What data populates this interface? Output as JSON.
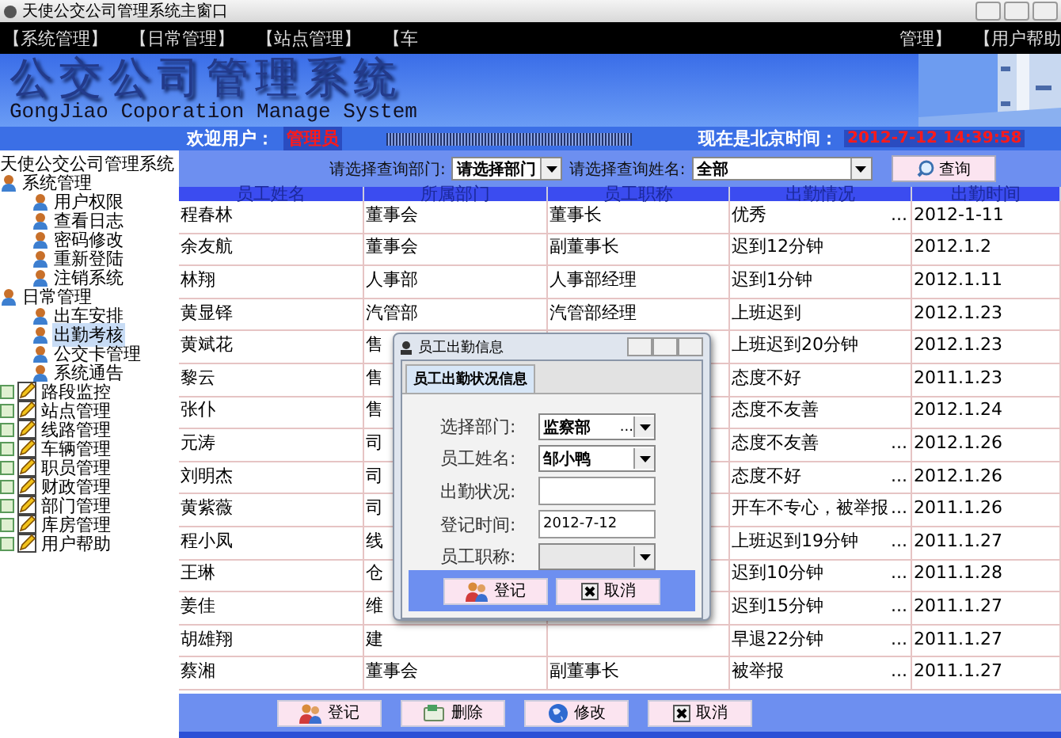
{
  "window": {
    "title": "天使公交公司管理系统主窗口"
  },
  "menu": [
    "【系统管理】",
    "【日常管理】",
    "【站点管理】",
    "【车",
    "管理】",
    "【用户帮助"
  ],
  "banner": {
    "title": "公交公司管理系统",
    "subtitle": "GongJiao Coporation Manage System"
  },
  "welcome": {
    "label": "欢迎用户：",
    "user": "管理员",
    "time_label": "现在是北京时间：",
    "time": "2012-7-12 14:39:58"
  },
  "tree": {
    "label": "天使公交公司管理系统",
    "children": [
      {
        "label": "系统管理",
        "expanded": true,
        "selected": false,
        "children": [
          {
            "label": "用户权限",
            "selected": false
          },
          {
            "label": "查看日志",
            "selected": false
          },
          {
            "label": "密码修改",
            "selected": false
          },
          {
            "label": "重新登陆",
            "selected": false
          },
          {
            "label": "注销系统",
            "selected": false
          }
        ]
      },
      {
        "label": "日常管理",
        "expanded": true,
        "selected": false,
        "children": [
          {
            "label": "出车安排",
            "selected": false
          },
          {
            "label": "出勤考核",
            "selected": true
          },
          {
            "label": "公交卡管理",
            "selected": false
          },
          {
            "label": "系统通告",
            "selected": false
          }
        ]
      },
      {
        "label": "路段监控",
        "expanded": false,
        "selected": false
      },
      {
        "label": "站点管理",
        "expanded": false,
        "selected": false
      },
      {
        "label": "线路管理",
        "expanded": false,
        "selected": false
      },
      {
        "label": "车辆管理",
        "expanded": false,
        "selected": false
      },
      {
        "label": "职员管理",
        "expanded": false,
        "selected": false
      },
      {
        "label": "财政管理",
        "expanded": false,
        "selected": false
      },
      {
        "label": "部门管理",
        "expanded": false,
        "selected": false
      },
      {
        "label": "库房管理",
        "expanded": false,
        "selected": false
      },
      {
        "label": "用户帮助",
        "expanded": false,
        "selected": false
      }
    ]
  },
  "query": {
    "dept_label": "请选择查询部门:",
    "dept_value": "请选择部门",
    "name_label": "请选择查询姓名:",
    "name_value": "全部",
    "button": "查询"
  },
  "table": {
    "columns": [
      "员工姓名",
      "所属部门",
      "员工职称",
      "出勤情况",
      "出勤时间"
    ],
    "rows": [
      {
        "name": "程春林",
        "dept": "董事会",
        "title": "董事长",
        "status": "优秀",
        "more": "...",
        "time": "2012-1-11"
      },
      {
        "name": "余友航",
        "dept": "董事会",
        "title": "副董事长",
        "status": "迟到12分钟",
        "time": "2012.1.2"
      },
      {
        "name": "林翔",
        "dept": "人事部",
        "title": "人事部经理",
        "status": "迟到1分钟",
        "time": "2012.1.11"
      },
      {
        "name": "黄显铎",
        "dept": "汽管部",
        "title": "汽管部经理",
        "status": "上班迟到",
        "time": "2012.1.23"
      },
      {
        "name": "黄斌花",
        "dept": "售",
        "status": "上班迟到20分钟",
        "time": "2012.1.23"
      },
      {
        "name": "黎云",
        "dept": "售",
        "status": "态度不好",
        "time": "2011.1.23"
      },
      {
        "name": "张仆",
        "dept": "售",
        "status": "态度不友善",
        "time": "2012.1.24"
      },
      {
        "name": "元涛",
        "dept": "司",
        "status": "态度不友善",
        "more": "...",
        "time": "2012.1.26"
      },
      {
        "name": "刘明杰",
        "dept": "司",
        "status": "态度不好",
        "more": "...",
        "time": "2012.1.26"
      },
      {
        "name": "黄紫薇",
        "dept": "司",
        "status": "开车不专心，被举报",
        "more": "...",
        "time": "2011.1.26"
      },
      {
        "name": "程小凤",
        "dept": "线",
        "status": "上班迟到19分钟",
        "more": "...",
        "time": "2011.1.27"
      },
      {
        "name": "王琳",
        "dept": "仓",
        "status": "迟到10分钟",
        "more": "...",
        "time": "2011.1.28"
      },
      {
        "name": "姜佳",
        "dept": "维",
        "status": "迟到15分钟",
        "more": "...",
        "time": "2011.1.27"
      },
      {
        "name": "胡雄翔",
        "dept": "建",
        "status": "早退22分钟",
        "more": "...",
        "time": "2011.1.27"
      },
      {
        "name": "蔡湘",
        "dept": "董事会",
        "title": "副董事长",
        "status": "被举报",
        "more": "...",
        "time": "2011.1.27"
      }
    ]
  },
  "actions": [
    {
      "kind": "register",
      "label": "登记"
    },
    {
      "kind": "delete",
      "label": "删除"
    },
    {
      "kind": "edit",
      "label": "修改"
    },
    {
      "kind": "cancel",
      "label": "取消"
    }
  ],
  "dialog": {
    "title": "员工出勤信息",
    "tabs": [
      {
        "label": "员工出勤状况信息",
        "selected": true
      }
    ],
    "fields": [
      {
        "kind": "combo",
        "label": "选择部门:",
        "value": "监察部",
        "more": "..."
      },
      {
        "kind": "combo",
        "label": "员工姓名:",
        "value": "邹小鸭"
      },
      {
        "kind": "text",
        "label": "出勤状况:"
      },
      {
        "kind": "text",
        "label": "登记时间:",
        "value": "2012-7-12"
      },
      {
        "kind": "combo",
        "label": "员工职称:"
      }
    ],
    "buttons": [
      {
        "kind": "register",
        "label": "登记"
      },
      {
        "kind": "cancel",
        "label": "取消"
      }
    ]
  }
}
